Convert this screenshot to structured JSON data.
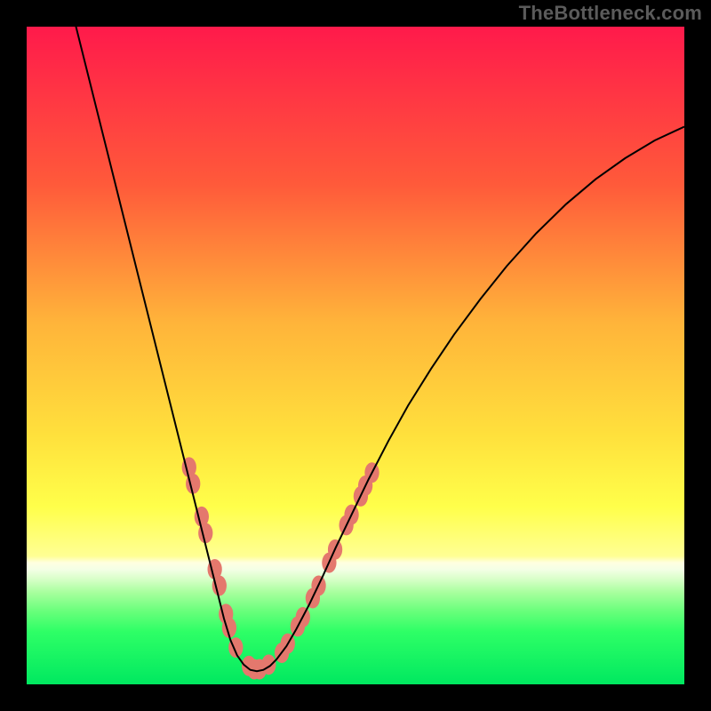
{
  "watermark": "TheBottleneck.com",
  "chart_data": {
    "type": "line",
    "title": "",
    "xlabel": "",
    "ylabel": "",
    "xlim_pct": [
      0,
      100
    ],
    "ylim_pct": [
      0,
      100
    ],
    "note": "No axis ticks or numeric labels are visible. Values are curve coordinates expressed in plot-area percentage (0=left/top, 100=right/bottom for SVG y).",
    "gradient_stops": [
      {
        "offset": 0,
        "color": "#ff1a4b"
      },
      {
        "offset": 24,
        "color": "#ff5a3a"
      },
      {
        "offset": 45,
        "color": "#ffb43a"
      },
      {
        "offset": 62,
        "color": "#ffe03c"
      },
      {
        "offset": 73,
        "color": "#ffff4a"
      },
      {
        "offset": 80.5,
        "color": "#ffff94"
      },
      {
        "offset": 81.5,
        "color": "#ffffe0"
      },
      {
        "offset": 82.5,
        "color": "#f4ffe6"
      },
      {
        "offset": 84,
        "color": "#d8ffc8"
      },
      {
        "offset": 86,
        "color": "#a8ff9e"
      },
      {
        "offset": 89,
        "color": "#66ff7a"
      },
      {
        "offset": 92,
        "color": "#2eff66"
      },
      {
        "offset": 100,
        "color": "#00e860"
      }
    ],
    "series": [
      {
        "name": "curve",
        "stroke": "#000000",
        "points_pct": [
          [
            7.0,
            -2.0
          ],
          [
            9.0,
            6.0
          ],
          [
            11.0,
            14.0
          ],
          [
            13.0,
            22.0
          ],
          [
            15.0,
            30.0
          ],
          [
            17.0,
            38.0
          ],
          [
            19.0,
            46.0
          ],
          [
            21.0,
            54.0
          ],
          [
            23.0,
            62.0
          ],
          [
            25.0,
            70.0
          ],
          [
            26.5,
            76.0
          ],
          [
            28.0,
            82.0
          ],
          [
            29.0,
            86.0
          ],
          [
            30.0,
            90.0
          ],
          [
            31.0,
            93.3
          ],
          [
            32.0,
            95.6
          ],
          [
            33.0,
            97.0
          ],
          [
            34.0,
            97.8
          ],
          [
            35.0,
            98.0
          ],
          [
            36.0,
            97.8
          ],
          [
            37.0,
            97.2
          ],
          [
            38.0,
            96.2
          ],
          [
            39.5,
            94.2
          ],
          [
            41.0,
            91.6
          ],
          [
            43.0,
            87.8
          ],
          [
            45.0,
            83.6
          ],
          [
            47.0,
            79.2
          ],
          [
            49.5,
            74.0
          ],
          [
            52.0,
            68.8
          ],
          [
            55.0,
            63.0
          ],
          [
            58.0,
            57.6
          ],
          [
            61.5,
            52.0
          ],
          [
            65.0,
            46.8
          ],
          [
            69.0,
            41.4
          ],
          [
            73.0,
            36.4
          ],
          [
            77.5,
            31.4
          ],
          [
            82.0,
            27.0
          ],
          [
            86.5,
            23.2
          ],
          [
            91.0,
            20.0
          ],
          [
            95.5,
            17.3
          ],
          [
            100.0,
            15.2
          ]
        ]
      },
      {
        "name": "dots",
        "note": "Salmon-colored highlight blobs along the V where background is pale yellow",
        "fill": "#e4786d",
        "points_pct": [
          [
            24.7,
            67.0
          ],
          [
            25.3,
            69.5
          ],
          [
            26.6,
            74.5
          ],
          [
            27.2,
            77.0
          ],
          [
            28.6,
            82.5
          ],
          [
            29.3,
            85.0
          ],
          [
            30.3,
            89.3
          ],
          [
            30.8,
            91.4
          ],
          [
            31.8,
            94.4
          ],
          [
            33.8,
            97.2
          ],
          [
            34.6,
            97.7
          ],
          [
            35.4,
            97.7
          ],
          [
            36.8,
            97.0
          ],
          [
            38.8,
            95.2
          ],
          [
            39.7,
            93.8
          ],
          [
            41.2,
            91.2
          ],
          [
            42.0,
            89.8
          ],
          [
            43.5,
            86.9
          ],
          [
            44.4,
            85.0
          ],
          [
            46.0,
            81.5
          ],
          [
            46.9,
            79.5
          ],
          [
            48.6,
            75.8
          ],
          [
            49.4,
            74.2
          ],
          [
            50.8,
            71.4
          ],
          [
            51.5,
            69.8
          ],
          [
            52.5,
            67.8
          ]
        ]
      }
    ]
  }
}
